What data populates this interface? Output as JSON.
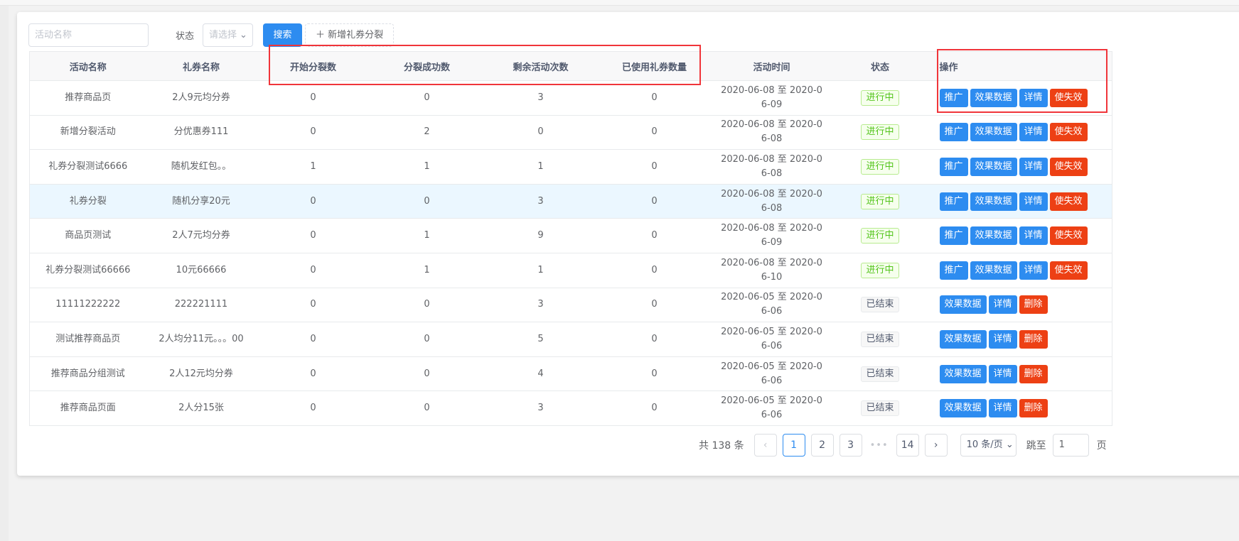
{
  "filters": {
    "name_placeholder": "活动名称",
    "status_label": "状态",
    "status_placeholder": "请选择",
    "search_label": "搜索",
    "add_label": "新增礼券分裂"
  },
  "columns": [
    "活动名称",
    "礼券名称",
    "开始分裂数",
    "分裂成功数",
    "剩余活动次数",
    "已使用礼券数量",
    "活动时间",
    "状态",
    "操作"
  ],
  "rows": [
    {
      "name": "推荐商品页",
      "coupon": "2人9元均分券",
      "start": "0",
      "success": "0",
      "remain": "3",
      "used": "0",
      "time1": "2020-06-08 至 2020-0",
      "time2": "6-09",
      "status": "进行中",
      "actions": [
        "推广",
        "效果数据",
        "详情",
        "使失效"
      ]
    },
    {
      "name": "新增分裂活动",
      "coupon": "分优惠券111",
      "start": "0",
      "success": "2",
      "remain": "0",
      "used": "0",
      "time1": "2020-06-08 至 2020-0",
      "time2": "6-08",
      "status": "进行中",
      "actions": [
        "推广",
        "效果数据",
        "详情",
        "使失效"
      ]
    },
    {
      "name": "礼券分裂测试6666",
      "coupon": "随机发红包。。",
      "start": "1",
      "success": "1",
      "remain": "1",
      "used": "0",
      "time1": "2020-06-08 至 2020-0",
      "time2": "6-08",
      "status": "进行中",
      "actions": [
        "推广",
        "效果数据",
        "详情",
        "使失效"
      ]
    },
    {
      "name": "礼券分裂",
      "coupon": "随机分享20元",
      "start": "0",
      "success": "0",
      "remain": "3",
      "used": "0",
      "time1": "2020-06-08 至 2020-0",
      "time2": "6-08",
      "status": "进行中",
      "actions": [
        "推广",
        "效果数据",
        "详情",
        "使失效"
      ]
    },
    {
      "name": "商品页测试",
      "coupon": "2人7元均分券",
      "start": "0",
      "success": "1",
      "remain": "9",
      "used": "0",
      "time1": "2020-06-08 至 2020-0",
      "time2": "6-09",
      "status": "进行中",
      "actions": [
        "推广",
        "效果数据",
        "详情",
        "使失效"
      ]
    },
    {
      "name": "礼券分裂测试66666",
      "coupon": "10元66666",
      "start": "0",
      "success": "1",
      "remain": "1",
      "used": "0",
      "time1": "2020-06-08 至 2020-0",
      "time2": "6-10",
      "status": "进行中",
      "actions": [
        "推广",
        "效果数据",
        "详情",
        "使失效"
      ]
    },
    {
      "name": "11111222222",
      "coupon": "222221111",
      "start": "0",
      "success": "0",
      "remain": "3",
      "used": "0",
      "time1": "2020-06-05 至 2020-0",
      "time2": "6-06",
      "status": "已结束",
      "actions": [
        "效果数据",
        "详情",
        "删除"
      ]
    },
    {
      "name": "测试推荐商品页",
      "coupon": "2人均分11元。。。00",
      "start": "0",
      "success": "0",
      "remain": "5",
      "used": "0",
      "time1": "2020-06-05 至 2020-0",
      "time2": "6-06",
      "status": "已结束",
      "actions": [
        "效果数据",
        "详情",
        "删除"
      ]
    },
    {
      "name": "推荐商品分组测试",
      "coupon": "2人12元均分券",
      "start": "0",
      "success": "0",
      "remain": "4",
      "used": "0",
      "time1": "2020-06-05 至 2020-0",
      "time2": "6-06",
      "status": "已结束",
      "actions": [
        "效果数据",
        "详情",
        "删除"
      ]
    },
    {
      "name": "推荐商品页面",
      "coupon": "2人分15张",
      "start": "0",
      "success": "0",
      "remain": "3",
      "used": "0",
      "time1": "2020-06-05 至 2020-0",
      "time2": "6-06",
      "status": "已结束",
      "actions": [
        "效果数据",
        "详情",
        "删除"
      ]
    }
  ],
  "pagination": {
    "total": "共 138 条",
    "pages": [
      "1",
      "2",
      "3",
      "14"
    ],
    "current": "1",
    "page_size": "10 条/页",
    "jump_label": "跳至",
    "jump_value": "1",
    "page_suffix": "页"
  },
  "colors": {
    "primary": "#2d8cf0",
    "danger": "#ed4014",
    "highlight": "#f0353a"
  }
}
